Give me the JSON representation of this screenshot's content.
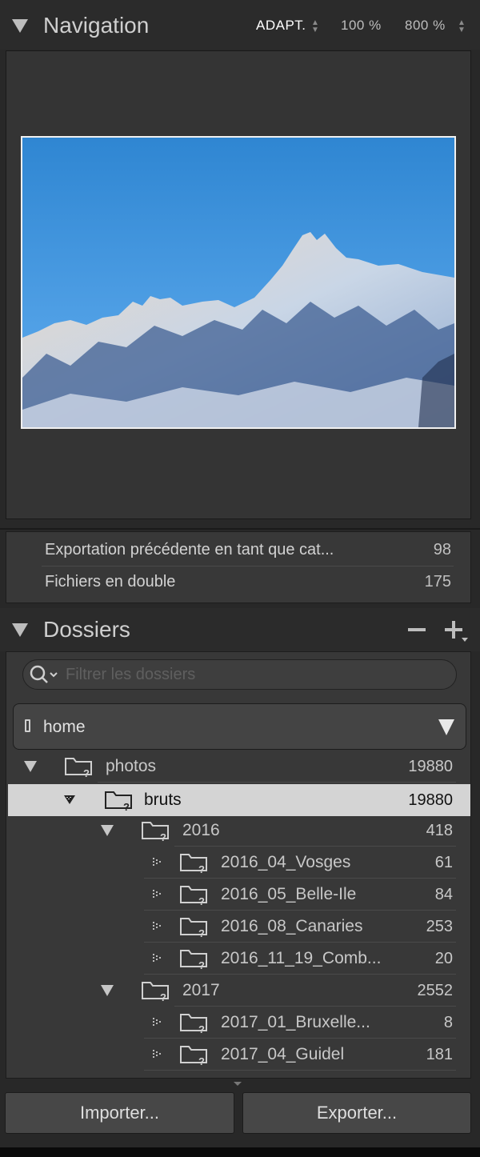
{
  "navigation": {
    "title": "Navigation",
    "zoom_options": [
      "ADAPT.",
      "100 %",
      "800 %"
    ],
    "active_zoom": "ADAPT."
  },
  "collections": {
    "items": [
      {
        "label": "Exportation précédente en tant que cat...",
        "count": "98"
      },
      {
        "label": "Fichiers en double",
        "count": "175"
      }
    ]
  },
  "folders": {
    "title": "Dossiers",
    "minus_label": "−",
    "plus_label": "+",
    "filter_placeholder": "Filtrer les dossiers",
    "volume": "home",
    "tree": [
      {
        "label": "photos",
        "count": "19880"
      },
      {
        "label": "bruts",
        "count": "19880",
        "selected": true
      },
      {
        "label": "2016",
        "count": "418"
      },
      {
        "label": "2016_04_Vosges",
        "count": "61"
      },
      {
        "label": "2016_05_Belle-Ile",
        "count": "84"
      },
      {
        "label": "2016_08_Canaries",
        "count": "253"
      },
      {
        "label": "2016_11_19_Comb...",
        "count": "20"
      },
      {
        "label": "2017",
        "count": "2552"
      },
      {
        "label": "2017_01_Bruxelle...",
        "count": "8"
      },
      {
        "label": "2017_04_Guidel",
        "count": "181"
      }
    ]
  },
  "buttons": {
    "import": "Importer...",
    "export": "Exporter..."
  },
  "colors": {
    "panel_bg": "#383838",
    "selected_row": "#d4d4d4",
    "sky": "#3a8fd6"
  }
}
